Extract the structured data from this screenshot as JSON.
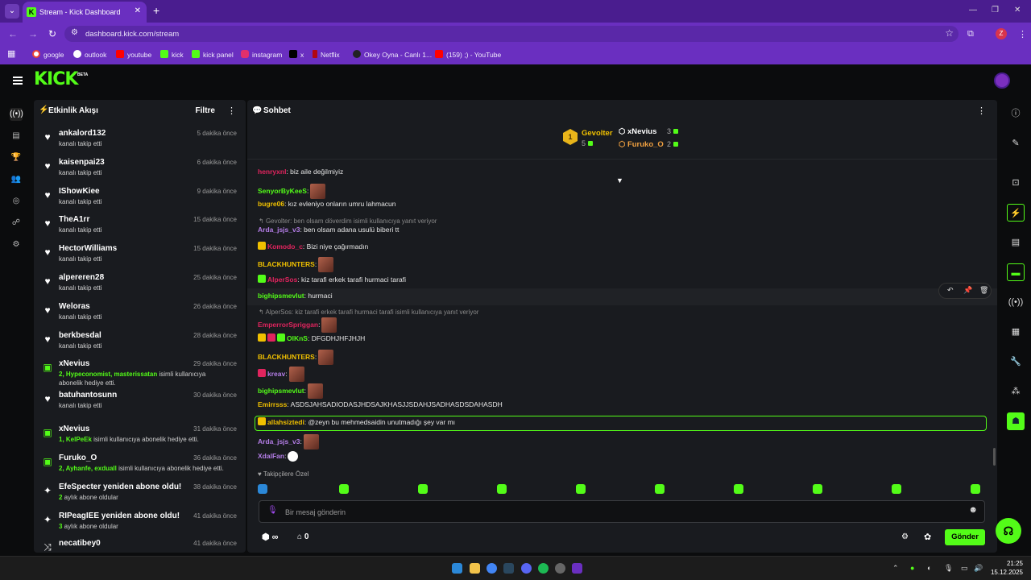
{
  "browser": {
    "tab_title": "Stream - Kick Dashboard",
    "url": "dashboard.kick.com/stream",
    "profile_initial": "Z",
    "bookmarks": [
      {
        "label": "google",
        "color": "#ea4335"
      },
      {
        "label": "outlook",
        "color": "#ffffff"
      },
      {
        "label": "youtube",
        "color": "#ff0000"
      },
      {
        "label": "kick",
        "color": "#53fc18"
      },
      {
        "label": "kick panel",
        "color": "#53fc18"
      },
      {
        "label": "instagram",
        "color": "#e1306c"
      },
      {
        "label": "x",
        "color": "#000000"
      },
      {
        "label": "Netflix",
        "color": "#b20710"
      },
      {
        "label": "Okey Oyna - Canlı 1...",
        "color": "#222222"
      },
      {
        "label": "(159) ;) - YouTube",
        "color": "#ff0000"
      }
    ]
  },
  "app": {
    "logo": "KICK",
    "beta": "BETA",
    "accent": "#53fc18"
  },
  "activity": {
    "title": "Etkinlik Akışı",
    "filter": "Filtre",
    "items": [
      {
        "icon": "heart-icon",
        "name": "ankalord132",
        "time": "5 dakika önce",
        "sub": "kanalı takip etti"
      },
      {
        "icon": "heart-icon",
        "name": "kaisenpai23",
        "time": "6 dakika önce",
        "sub": "kanalı takip etti"
      },
      {
        "icon": "heart-icon",
        "name": "IShowKiee",
        "time": "9 dakika önce",
        "sub": "kanalı takip etti"
      },
      {
        "icon": "heart-icon",
        "name": "TheA1rr",
        "time": "15 dakika önce",
        "sub": "kanalı takip etti"
      },
      {
        "icon": "heart-icon",
        "name": "HectorWilliams",
        "time": "15 dakika önce",
        "sub": "kanalı takip etti"
      },
      {
        "icon": "heart-icon",
        "name": "alpereren28",
        "time": "25 dakika önce",
        "sub": "kanalı takip etti"
      },
      {
        "icon": "heart-icon",
        "name": "Weloras",
        "time": "26 dakika önce",
        "sub": "kanalı takip etti"
      },
      {
        "icon": "heart-icon",
        "name": "berkbesdal",
        "time": "28 dakika önce",
        "sub": "kanalı takip etti"
      },
      {
        "icon": "gift-icon",
        "name": "xNevius",
        "time": "29 dakika önce",
        "sub_green": "2, Hypeconomist, masterissatan",
        "sub": " isimli kullanıcıya",
        "sub2": "abonelik hediye etti."
      },
      {
        "icon": "heart-icon",
        "name": "batuhantosunn",
        "time": "30 dakika önce",
        "sub": "kanalı takip etti"
      },
      {
        "icon": "gift-icon",
        "name": "xNevius",
        "time": "31 dakika önce",
        "sub_green": "1, KelPeEk",
        "sub": " isimli kullanıcıya abonelik hediye etti."
      },
      {
        "icon": "gift-icon",
        "name": "Furuko_O",
        "time": "36 dakika önce",
        "sub_green": "2, Ayhanfe, exduall",
        "sub": " isimli kullanıcıya abonelik hediye etti."
      },
      {
        "icon": "sparkle-icon",
        "name": "EfeSpecter yeniden abone oldu!",
        "time": "38 dakika önce",
        "sub_green": "2",
        "sub": " aylık abone oldular"
      },
      {
        "icon": "sparkle-icon",
        "name": "RIPeagIEE yeniden abone oldu!",
        "time": "41 dakika önce",
        "sub_green": "3",
        "sub": " aylık abone oldular"
      },
      {
        "icon": "raid-icon",
        "name": "necatibey0",
        "time": "41 dakika önce",
        "sub": ""
      }
    ]
  },
  "chat": {
    "title": "Sohbet",
    "leaderboard": {
      "first": {
        "name": "Gevolter",
        "count": "5",
        "rank": "1"
      },
      "second": {
        "name": "xNevius",
        "count": "3"
      },
      "third": {
        "name": "Furuko_O",
        "count": "2"
      }
    },
    "messages": [
      {
        "user": "henryxnl",
        "color": "#e0245e",
        "text": ": biz aile değilmiyiz"
      },
      {
        "user": "SenyorByKeeS",
        "color": "#53fc18",
        "text": ":",
        "emote": true
      },
      {
        "user": "bugre06",
        "color": "#f0c000",
        "text": ": kız evleniyo onların umru lahmacun"
      },
      {
        "reply": "Gevolter: ben olsam döverdim isimli kullanıcıya yanıt veriyor"
      },
      {
        "user": "Arda_jsjs_v3",
        "color": "#b57ee8",
        "text": ": ben olsam adana usulü biberi tt"
      },
      {
        "user": "Komodo_c",
        "color": "#e0245e",
        "text": ": Bizi niye çağırmadın",
        "badge": "crown"
      },
      {
        "user": "BLACKHUNTERS",
        "color": "#f0c000",
        "text": ":",
        "emote": true
      },
      {
        "user": "AlperSos",
        "color": "#e0245e",
        "text": ": kiz tarafi erkek tarafi hurmaci tarafi",
        "badge": "frog"
      },
      {
        "user": "bighipsmevlut",
        "color": "#53fc18",
        "text": ": hurmaci"
      },
      {
        "reply": "AlperSos: kiz tarafi erkek tarafi hurmaci tarafi isimli kullanıcıya yanıt veriyor"
      },
      {
        "user": "EmperrorSpriggan",
        "color": "#e0245e",
        "text": ":",
        "emote": true
      },
      {
        "user": "OlKnS",
        "color": "#53fc18",
        "text": ": DFGDHJHFJHJH",
        "badge": "triple"
      },
      {
        "user": "BLACKHUNTERS",
        "color": "#f0c000",
        "text": ":",
        "emote": true
      },
      {
        "user": "kreav",
        "color": "#b57ee8",
        "text": ":",
        "emote": true,
        "badge": "mask"
      },
      {
        "user": "bighipsmevlut",
        "color": "#53fc18",
        "text": ":",
        "emote": true
      },
      {
        "user": "Emirrsss",
        "color": "#f0c000",
        "text": ": ASDSJAHSADIODASJHDSAJKHASJJSDAHJSADHASDSDAHASDH"
      },
      {
        "user": "allahsiztedi",
        "color": "#f0c000",
        "text": ": @zeyn bu mehmedsaidin unutmadığı şey var mı",
        "badge": "gold"
      },
      {
        "user": "Arda_jsjs_v3",
        "color": "#b57ee8",
        "text": ":",
        "emote": true
      },
      {
        "user": "XdalFan",
        "color": "#b57ee8",
        "text": ":",
        "emote": "duck"
      }
    ],
    "emote_label": "Takipçilere Özel",
    "input_placeholder": "Bir mesaj gönderin",
    "infinity": "∞",
    "shop_count": "0",
    "send": "Gönder"
  },
  "taskbar": {
    "time": "21:25",
    "date": "15.12.2025"
  }
}
